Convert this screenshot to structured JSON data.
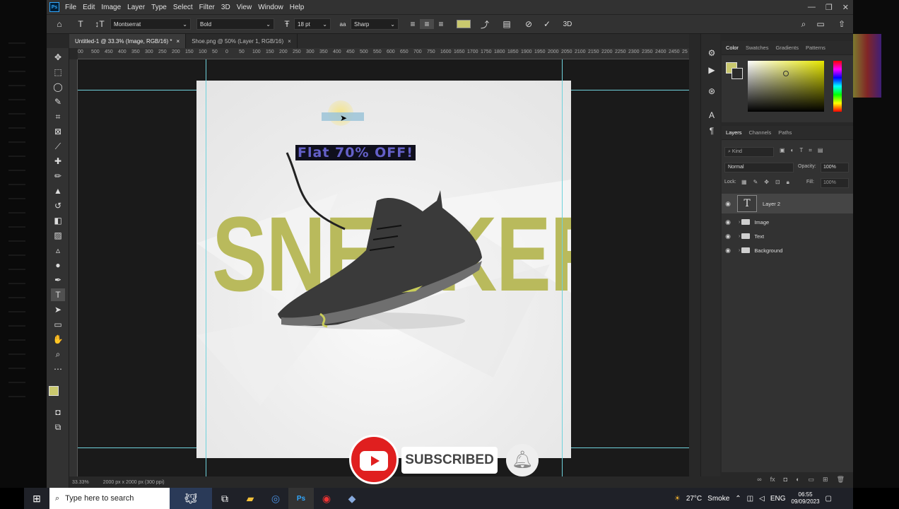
{
  "menu": {
    "ps_logo": "Ps",
    "items": [
      "File",
      "Edit",
      "Image",
      "Layer",
      "Type",
      "Select",
      "Filter",
      "3D",
      "View",
      "Window",
      "Help"
    ]
  },
  "options": {
    "font_family": "Montserrat",
    "font_style": "Bold",
    "font_size": "18 pt",
    "aa_label": "aa",
    "antialias": "Sharp"
  },
  "tabs": [
    {
      "label": "Untitled-1 @ 33.3% (Image, RGB/16) *"
    },
    {
      "label": "Shoe.png @ 50% (Layer 1, RGB/16)"
    }
  ],
  "ruler_ticks": [
    "00",
    "500",
    "450",
    "400",
    "350",
    "300",
    "250",
    "200",
    "150",
    "100",
    "50",
    "0",
    "50",
    "100",
    "150",
    "200",
    "250",
    "300",
    "350",
    "400",
    "450",
    "500",
    "550",
    "600",
    "650",
    "700",
    "750",
    "1600",
    "1650",
    "1700",
    "1750",
    "1800",
    "1850",
    "1900",
    "1950",
    "2000",
    "2050",
    "2100",
    "2150",
    "2200",
    "2250",
    "2300",
    "2350",
    "2400",
    "2450",
    "25"
  ],
  "canvas": {
    "promo_text": "Flat 70% OFF!",
    "headline": "SNEAKER"
  },
  "status": {
    "zoom": "33.33%",
    "doc_info": "2000 px x 2000 px (300 ppi)"
  },
  "color_panel": {
    "tabs": [
      "Color",
      "Swatches",
      "Gradients",
      "Patterns"
    ],
    "fg": "#c9c86e",
    "bg": "#2a2a2a"
  },
  "layers_panel": {
    "tabs": [
      "Layers",
      "Channels",
      "Paths"
    ],
    "kind_label": "Kind",
    "blend": "Normal",
    "opacity_label": "Opacity:",
    "opacity": "100%",
    "lock_label": "Lock:",
    "fill_label": "Fill:",
    "fill": "100%",
    "layers": [
      {
        "name": "Layer 2",
        "type": "text"
      },
      {
        "name": "Image",
        "type": "group"
      },
      {
        "name": "Text",
        "type": "group"
      },
      {
        "name": "Background",
        "type": "group"
      }
    ]
  },
  "overlay": {
    "subscribe_label": "SUBSCRIBED"
  },
  "taskbar": {
    "search_placeholder": "Type here to search",
    "weather": "27°C",
    "weather_desc": "Smoke",
    "lang": "ENG",
    "time": "06:55",
    "date": "09/09/2023"
  }
}
